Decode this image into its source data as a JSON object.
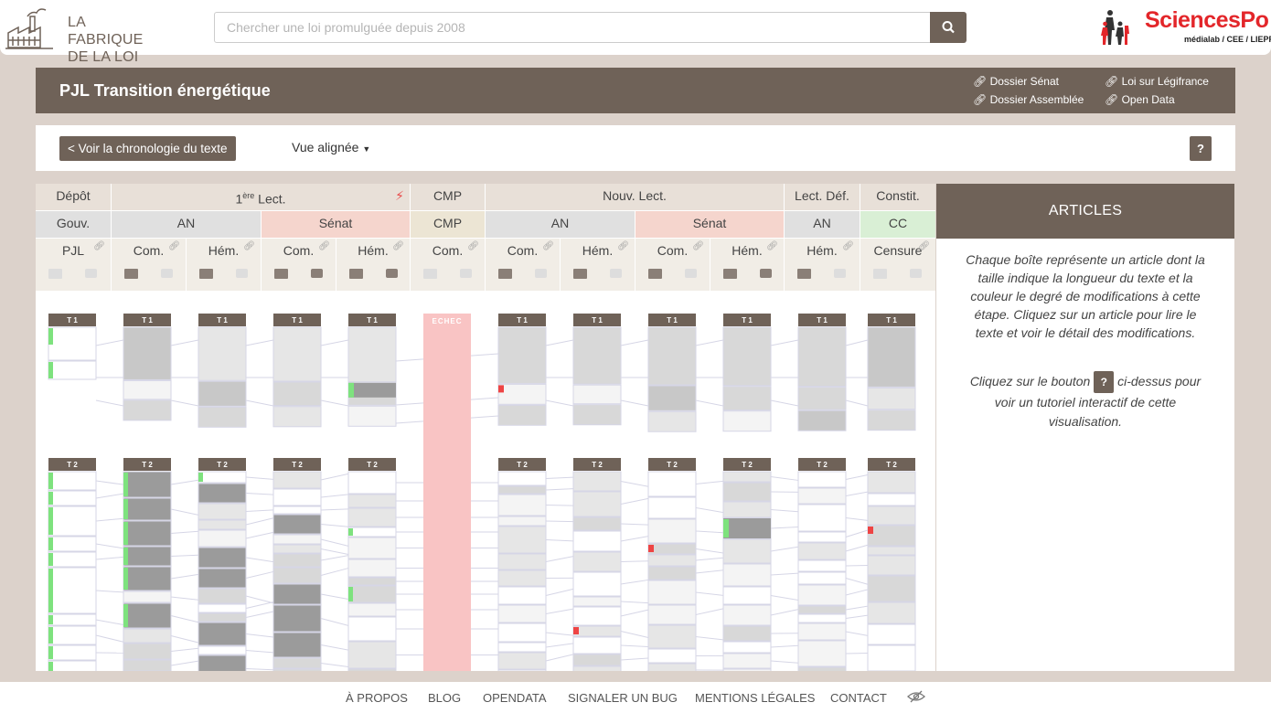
{
  "header": {
    "logo_line1": "LA FABRIQUE",
    "logo_line2": "DE LA LOI",
    "search_placeholder": "Chercher une loi promulguée depuis 2008",
    "partner_name": "SciencesPo",
    "partner_sub": "médialab / CEE / LIEPP"
  },
  "banner": {
    "title": "PJL Transition énergétique",
    "links": [
      "Dossier Sénat",
      "Dossier Assemblée",
      "Loi sur Légifrance",
      "Open Data"
    ]
  },
  "controls": {
    "chrono_label": "< Voir la chronologie du texte",
    "view_label": "Vue alignée",
    "help_label": "?"
  },
  "stages": {
    "depot": "Dépôt",
    "lect1_prefix": "1",
    "lect1_sup": "ère",
    "lect1_suffix": " Lect.",
    "cmp": "CMP",
    "nouv": "Nouv. Lect.",
    "lectdef": "Lect. Déf.",
    "constit": "Constit."
  },
  "institutions": [
    "Gouv.",
    "AN",
    "Sénat",
    "CMP",
    "AN",
    "Sénat",
    "AN",
    "CC"
  ],
  "steps": [
    "PJL",
    "Com.",
    "Hém.",
    "Com.",
    "Hém.",
    "Com.",
    "Com.",
    "Hém.",
    "Com.",
    "Hém.",
    "Hém.",
    "Censure"
  ],
  "titles": {
    "t1": "T 1",
    "t2": "T 2",
    "echec": "ECHEC"
  },
  "sidebar": {
    "heading": "ARTICLES",
    "text1": "Chaque boîte représente un article dont la taille indique la longueur du texte et la couleur le degré de modifications à cette étape. Cliquez sur un article pour lire le texte et voir le détail des modifications.",
    "text2_a": "Cliquez sur le bouton",
    "text2_badge": "?",
    "text2_b": "ci-dessus pour voir un tutoriel interactif de cette visualisation."
  },
  "footer": [
    "À PROPOS",
    "BLOG",
    "OPENDATA",
    "SIGNALER UN BUG",
    "MENTIONS LÉGALES",
    "CONTACT"
  ],
  "colors": {
    "brand": "#6f6258",
    "senat_bg": "#f5d5cd",
    "cmp_bg": "#ece5d4",
    "cc_bg": "#d9efd5",
    "echec": "#f9c4c4",
    "added": "#7ee27e",
    "removed": "#ee4444"
  }
}
